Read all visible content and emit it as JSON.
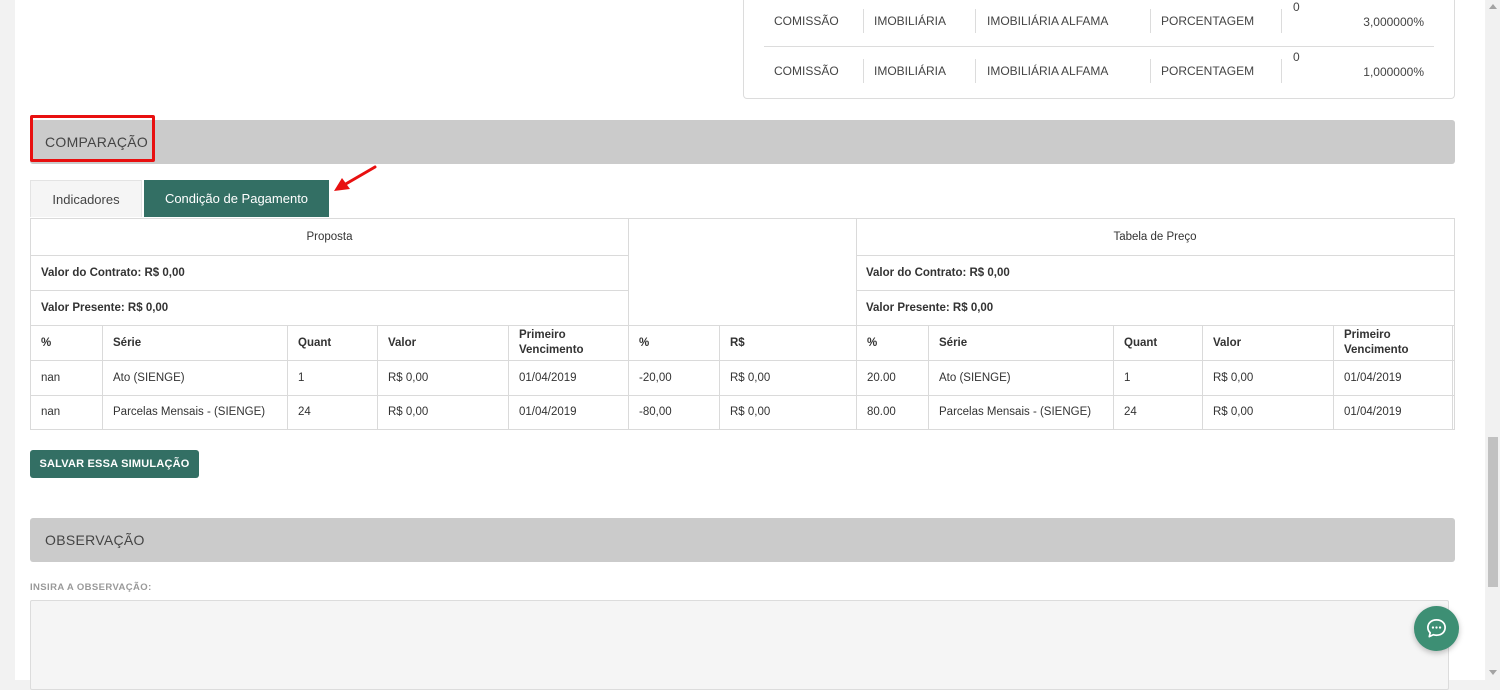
{
  "commissions": [
    {
      "type": "COMISSÃO",
      "entity": "IMOBILIÁRIA",
      "name": "IMOBILIÁRIA ALFAMA",
      "mode": "PORCENTAGEM",
      "zero": "0",
      "value": "3,000000%"
    },
    {
      "type": "COMISSÃO",
      "entity": "IMOBILIÁRIA",
      "name": "IMOBILIÁRIA ALFAMA",
      "mode": "PORCENTAGEM",
      "zero": "0",
      "value": "1,000000%"
    }
  ],
  "comparacao": {
    "title": "COMPARAÇÃO",
    "tabs": [
      "Indicadores",
      "Condição de Pagamento"
    ],
    "active_tab": "Condição de Pagamento"
  },
  "table": {
    "proposta_title": "Proposta",
    "tabela_title": "Tabela de Preço",
    "proposta_valor_contrato": "Valor do Contrato: R$ 0,00",
    "proposta_valor_presente": "Valor Presente: R$ 0,00",
    "tabela_valor_contrato": "Valor do Contrato: R$ 0,00",
    "tabela_valor_presente": "Valor Presente: R$ 0,00",
    "headers": [
      "%",
      "Série",
      "Quant",
      "Valor",
      "Primeiro Vencimento",
      "%",
      "R$",
      "%",
      "Série",
      "Quant",
      "Valor",
      "Primeiro Vencimento"
    ],
    "rows": [
      [
        "nan",
        "Ato (SIENGE)",
        "1",
        "R$ 0,00",
        "01/04/2019",
        "-20,00",
        "R$ 0,00",
        "20.00",
        "Ato (SIENGE)",
        "1",
        "R$ 0,00",
        "01/04/2019"
      ],
      [
        "nan",
        "Parcelas Mensais - (SIENGE)",
        "24",
        "R$ 0,00",
        "01/04/2019",
        "-80,00",
        "R$ 0,00",
        "80.00",
        "Parcelas Mensais - (SIENGE)",
        "24",
        "R$ 0,00",
        "01/04/2019"
      ]
    ]
  },
  "save_button": "SALVAR ESSA SIMULAÇÃO",
  "observacao": {
    "title": "OBSERVAÇÃO",
    "label": "INSIRA A OBSERVAÇÃO:",
    "value": ""
  },
  "colors": {
    "primary": "#336f64",
    "highlight": "#e81010",
    "section_bg": "#cbcbcb",
    "chat": "#3d8f74"
  },
  "icons": [
    "chat-bubble-icon",
    "annotation-arrow-icon"
  ]
}
